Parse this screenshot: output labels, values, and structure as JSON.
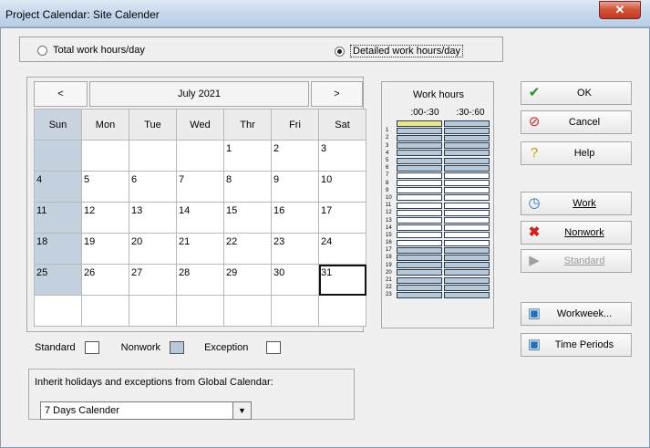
{
  "window": {
    "title": "Project Calendar: Site Calender",
    "close_glyph": "✕"
  },
  "mode": {
    "total_label": "Total work hours/day",
    "detailed_label": "Detailed work hours/day",
    "selected": "detailed"
  },
  "calendar": {
    "prev": "<",
    "next": ">",
    "month": "July 2021",
    "weekdays": [
      "Sun",
      "Mon",
      "Tue",
      "Wed",
      "Thr",
      "Fri",
      "Sat"
    ],
    "weeks": [
      [
        "",
        "",
        "",
        "",
        "1",
        "2",
        "3"
      ],
      [
        "4",
        "5",
        "6",
        "7",
        "8",
        "9",
        "10"
      ],
      [
        "11",
        "12",
        "13",
        "14",
        "15",
        "16",
        "17"
      ],
      [
        "18",
        "19",
        "20",
        "21",
        "22",
        "23",
        "24"
      ],
      [
        "25",
        "26",
        "27",
        "28",
        "29",
        "30",
        "31"
      ],
      [
        "",
        "",
        "",
        "",
        "",
        "",
        ""
      ]
    ],
    "selected_day": "31"
  },
  "work_hours": {
    "title": "Work hours",
    "col1": ":00-:30",
    "col2": ":30-:60",
    "hours": [
      "",
      "1",
      "2",
      "3",
      "4",
      "5",
      "6",
      "7",
      "8",
      "9",
      "10",
      "11",
      "12",
      "13",
      "14",
      "15",
      "16",
      "17",
      "18",
      "19",
      "20",
      "21",
      "22",
      "23"
    ],
    "nonwork_hours": [
      0,
      1,
      2,
      3,
      4,
      5,
      6,
      17,
      18,
      19,
      20,
      21,
      22,
      23
    ]
  },
  "buttons": {
    "ok": "OK",
    "cancel": "Cancel",
    "help": "Help",
    "work": "Work",
    "nonwork": "Nonwork",
    "standard": "Standard",
    "workweek": "Workweek...",
    "time_periods": "Time Periods"
  },
  "legend": {
    "standard": "Standard",
    "nonwork": "Nonwork",
    "exception": "Exception"
  },
  "inherit": {
    "label": "Inherit holidays and exceptions from Global Calendar:",
    "value": "7 Days Calender"
  },
  "colors": {
    "sunday_fill": "#c4d1de",
    "nonwork_fill": "#b7c8d8",
    "selected_slot": "#e8e88a"
  }
}
